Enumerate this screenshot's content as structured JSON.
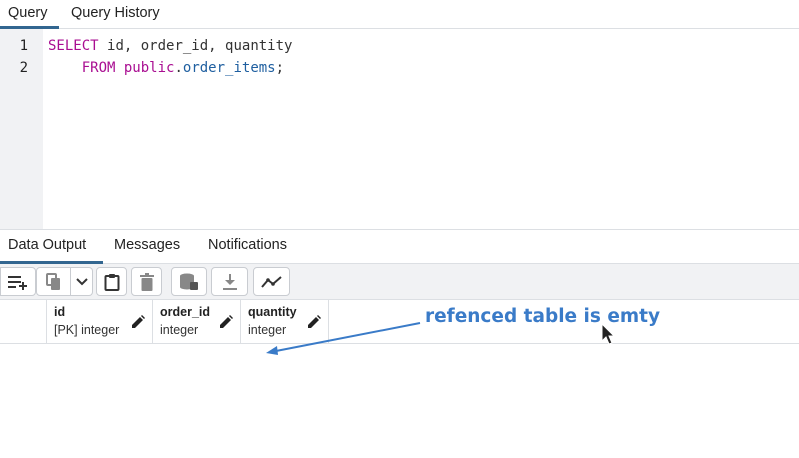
{
  "tabs": {
    "query": "Query",
    "history": "Query History"
  },
  "editor": {
    "line_numbers": [
      "1",
      "2"
    ],
    "line1": {
      "kw_select": "SELECT",
      "col_id": "id",
      "sep1": ", ",
      "col_order": "order_id",
      "sep2": ", ",
      "col_qty": "quantity"
    },
    "line2": {
      "indent": "    ",
      "kw_from": "FROM",
      "space": " ",
      "schema": "public",
      "dot": ".",
      "table": "order_items",
      "semi": ";"
    }
  },
  "output_tabs": {
    "data_output": "Data Output",
    "messages": "Messages",
    "notifications": "Notifications"
  },
  "toolbar_icons": [
    "add-row-icon",
    "copy-icon",
    "chevron-down-icon",
    "paste-icon",
    "delete-icon",
    "save-data-icon",
    "download-icon",
    "graph-icon"
  ],
  "columns": [
    {
      "name": "id",
      "type": "[PK] integer"
    },
    {
      "name": "order_id",
      "type": "integer"
    },
    {
      "name": "quantity",
      "type": "integer"
    }
  ],
  "annotation": {
    "text": "refenced table is emty",
    "color": "#3a7bc8"
  },
  "colors": {
    "accent": "#326690",
    "keyword": "#a90d91",
    "property": "#1f5fa0"
  }
}
